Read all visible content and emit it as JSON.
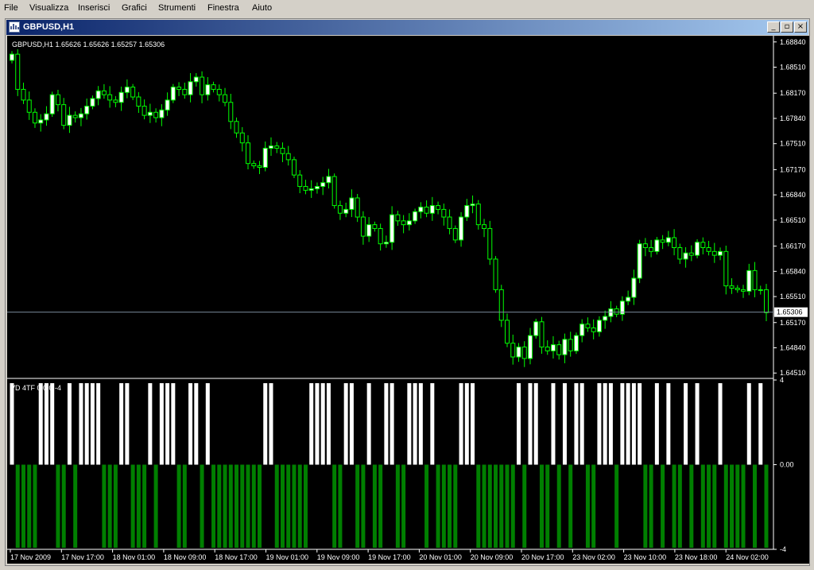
{
  "menu": [
    "File",
    "Visualizza",
    "Inserisci",
    "Grafici",
    "Strumenti",
    "Finestra",
    "Aiuto"
  ],
  "window": {
    "title": "GBPUSD,H1",
    "minimize_glyph": "_",
    "restore_glyph": "▫",
    "close_glyph": "×"
  },
  "colors": {
    "background": "#000000",
    "bull": "#ffffff",
    "bear": "#000000",
    "wick": "#00ff00",
    "axis": "#ffffff",
    "price_line": "#778899",
    "histo_up": "#ffffff",
    "histo_down": "#007f00"
  },
  "chart_data": [
    {
      "type": "candlestick",
      "header": "GBPUSD,H1  1.65626 1.65626 1.65257 1.65306",
      "y_ticks": [
        "1.68840",
        "1.68510",
        "1.68170",
        "1.67840",
        "1.67510",
        "1.67170",
        "1.66840",
        "1.66510",
        "1.66170",
        "1.65840",
        "1.65510",
        "1.65170",
        "1.64840",
        "1.64510"
      ],
      "ylim": [
        1.6445,
        1.689
      ],
      "current_price": "1.65306",
      "closes": [
        1.6868,
        1.6822,
        1.6808,
        1.6792,
        1.6778,
        1.6782,
        1.679,
        1.6815,
        1.6802,
        1.6775,
        1.6788,
        1.6785,
        1.679,
        1.68,
        1.681,
        1.682,
        1.6815,
        1.6808,
        1.6805,
        1.6818,
        1.6825,
        1.6812,
        1.68,
        1.6788,
        1.6792,
        1.6785,
        1.6795,
        1.6808,
        1.6825,
        1.6822,
        1.6815,
        1.6832,
        1.6838,
        1.6815,
        1.6828,
        1.6822,
        1.6815,
        1.6805,
        1.678,
        1.6765,
        1.6752,
        1.6725,
        1.6722,
        1.672,
        1.6745,
        1.6748,
        1.6745,
        1.6738,
        1.673,
        1.671,
        1.6695,
        1.669,
        1.6692,
        1.6695,
        1.67,
        1.6708,
        1.667,
        1.666,
        1.6665,
        1.668,
        1.6655,
        1.663,
        1.6645,
        1.664,
        1.662,
        1.6622,
        1.6658,
        1.665,
        1.6645,
        1.665,
        1.6662,
        1.6668,
        1.666,
        1.667,
        1.6665,
        1.6655,
        1.664,
        1.6625,
        1.6655,
        1.667,
        1.6672,
        1.6645,
        1.664,
        1.66,
        1.656,
        1.652,
        1.649,
        1.6472,
        1.6485,
        1.647,
        1.65,
        1.6518,
        1.6485,
        1.648,
        1.6488,
        1.6475,
        1.6495,
        1.648,
        1.65,
        1.6515,
        1.651,
        1.6505,
        1.652,
        1.6525,
        1.6535,
        1.6528,
        1.6545,
        1.655,
        1.6575,
        1.662,
        1.6615,
        1.661,
        1.6625,
        1.6622,
        1.6628,
        1.6615,
        1.66,
        1.6608,
        1.6605,
        1.6622,
        1.6615,
        1.661,
        1.6605,
        1.661,
        1.6565,
        1.6562,
        1.656,
        1.6558,
        1.6585,
        1.656,
        1.656,
        1.653
      ],
      "source": "reconstructed visual approximation"
    },
    {
      "type": "bar",
      "label": "VD 4TF 0 0 0 -4",
      "y_ticks": [
        "4",
        "0.00",
        "-4"
      ],
      "ylim": [
        -4,
        4
      ]
    }
  ],
  "x_ticks": [
    "17 Nov 2009",
    "17 Nov 17:00",
    "18 Nov 01:00",
    "18 Nov 09:00",
    "18 Nov 17:00",
    "19 Nov 01:00",
    "19 Nov 09:00",
    "19 Nov 17:00",
    "20 Nov 01:00",
    "20 Nov 09:00",
    "20 Nov 17:00",
    "23 Nov 02:00",
    "23 Nov 10:00",
    "23 Nov 18:00",
    "24 Nov 02:00"
  ]
}
